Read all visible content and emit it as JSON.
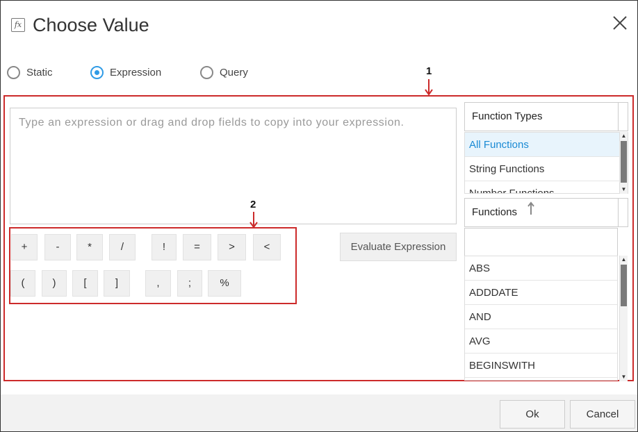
{
  "dialog": {
    "title": "Choose Value",
    "icon": "fx-icon",
    "icon_text": "fx"
  },
  "mode": {
    "options": [
      "Static",
      "Expression",
      "Query"
    ],
    "selected": "Expression"
  },
  "callouts": [
    "1",
    "2"
  ],
  "expression": {
    "placeholder": "Type an expression or drag and drop fields to copy into your expression.",
    "value": ""
  },
  "operators": {
    "row1": [
      "+",
      "-",
      "*",
      "/",
      "!",
      "=",
      ">",
      "<"
    ],
    "row2": [
      "(",
      ")",
      "[",
      "]",
      ",",
      ";",
      "%"
    ]
  },
  "evaluate_label": "Evaluate Expression",
  "function_types": {
    "header": "Function Types",
    "items": [
      "All Functions",
      "String Functions",
      "Number Functions"
    ],
    "selected": "All Functions"
  },
  "functions": {
    "header": "Functions",
    "search_value": "",
    "items": [
      "ABS",
      "ADDDATE",
      "AND",
      "AVG",
      "BEGINSWITH"
    ]
  },
  "footer": {
    "ok_label": "Ok",
    "cancel_label": "Cancel"
  },
  "colors": {
    "accent": "#2f9be6",
    "callout_red": "#cc2a2a",
    "selected_bg": "#e8f4fc"
  }
}
